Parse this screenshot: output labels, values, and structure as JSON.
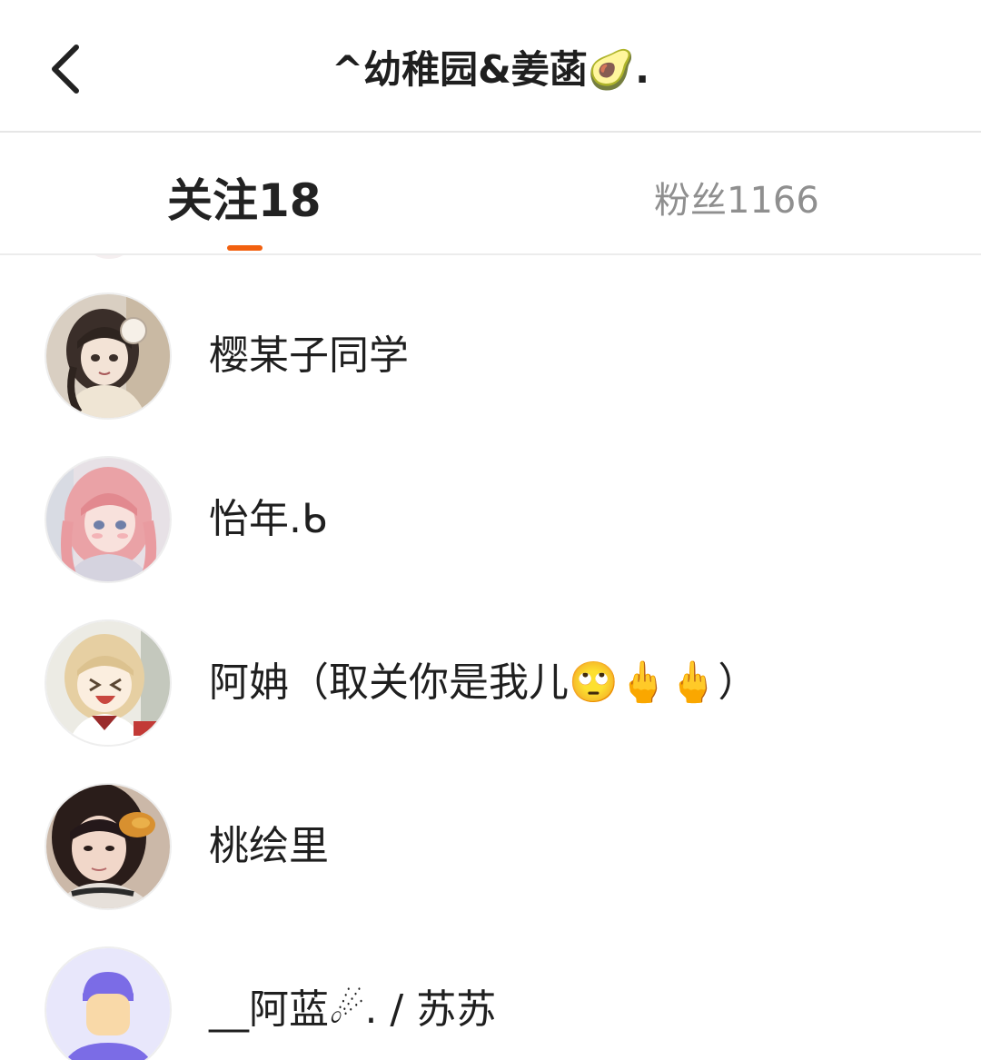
{
  "header": {
    "back_icon": "chevron-left-icon",
    "title": "^幼稚园&姜菡🥑."
  },
  "tabs": [
    {
      "label": "关注18",
      "active": true
    },
    {
      "label": "粉丝1166",
      "active": false
    }
  ],
  "colors": {
    "accent": "#f2600f",
    "inactive_tab": "#8f8f8f",
    "divider": "#e6e6e6"
  },
  "following_list": [
    {
      "name": "樱某子同学",
      "avatar": "anime-girl-headphones-avatar"
    },
    {
      "name": "怡年.ᑲ",
      "avatar": "anime-girl-pink-hair-avatar"
    },
    {
      "name": "阿姌（取关你是我儿🙄🖕🖕）",
      "avatar": "anime-girl-laughing-avatar"
    },
    {
      "name": "桃绘里",
      "avatar": "girl-photo-eating-avatar"
    },
    {
      "name": "__阿蓝☄. / 苏苏",
      "avatar": "default-user-avatar"
    }
  ]
}
